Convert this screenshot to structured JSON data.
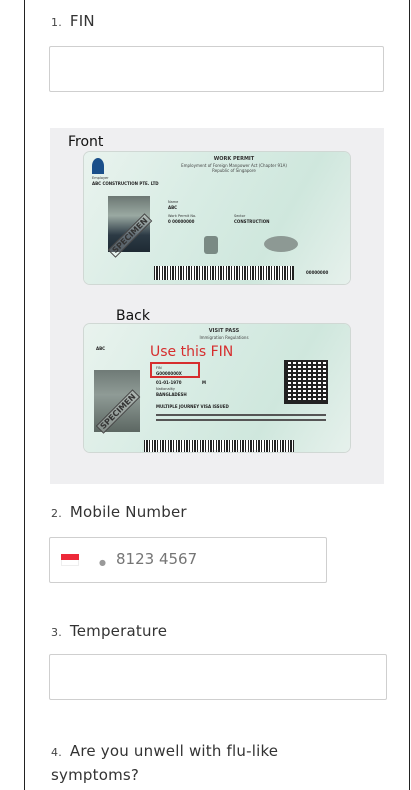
{
  "questions": [
    {
      "number": "1.",
      "label": "FIN",
      "value": ""
    },
    {
      "number": "2.",
      "label": "Mobile Number",
      "placeholder": "8123 4567"
    },
    {
      "number": "3.",
      "label": "Temperature",
      "value": ""
    },
    {
      "number": "4.",
      "label": "Are you unwell with flu-like",
      "label_line2": "symptoms?"
    }
  ],
  "illustration": {
    "front_label": "Front",
    "back_label": "Back",
    "fin_hint": "Use this FIN",
    "front_card": {
      "title": "WORK PERMIT",
      "subtitle": "Employment of Foreign Manpower Act (Chapter 91A)",
      "country": "Republic of Singapore",
      "employer_label": "Employer",
      "employer": "ABC CONSTRUCTION PTE. LTD",
      "name_label": "Name",
      "name": "ABC",
      "work_permit_label": "Work Permit No.",
      "work_permit": "0 00000000",
      "sector_label": "Sector",
      "sector": "CONSTRUCTION",
      "serial": "00000000",
      "stamp": "SPECIMEN"
    },
    "back_card": {
      "title": "VISIT PASS",
      "subtitle": "Immigration Regulations",
      "name": "ABC",
      "fin_label": "FIN",
      "fin": "G0000000X",
      "dob": "01-01-1970",
      "sex": "M",
      "nationality_label": "Nationality",
      "nationality": "BANGLADESH",
      "journey": "MULTIPLE JOURNEY VISA ISSUED",
      "stamp": "SPECIMEN"
    }
  },
  "colors": {
    "accent_red": "#d62e2e",
    "flag_red": "#ed2939",
    "border": "#cfcfcf"
  },
  "icons": {
    "country_flag": "singapore-flag-icon",
    "dropdown": "dropdown-dot-icon"
  }
}
